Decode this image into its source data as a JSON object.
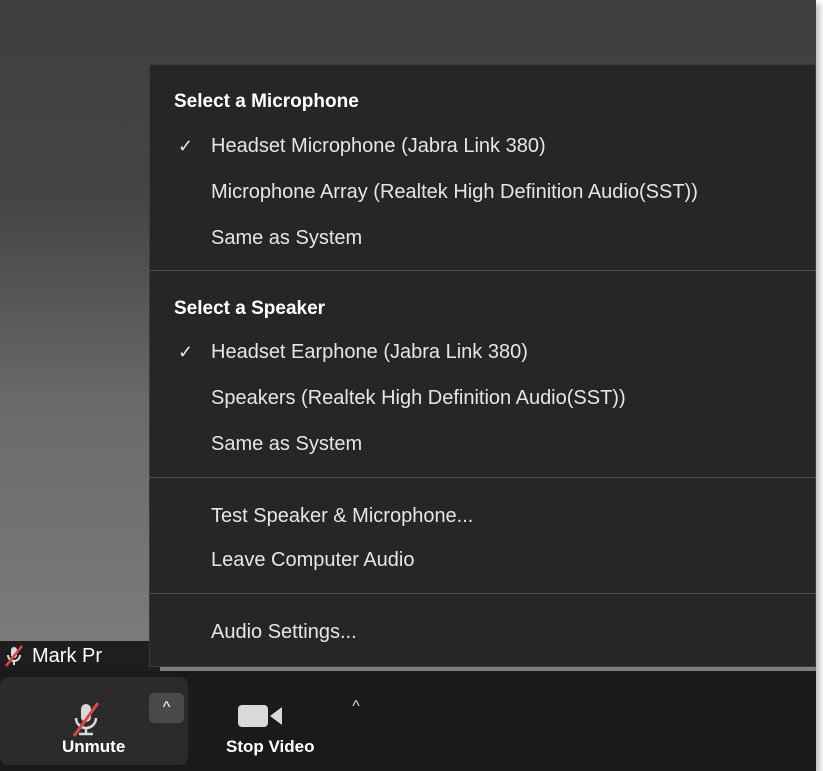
{
  "participant": {
    "name": "Mark Pr"
  },
  "audio_menu": {
    "microphone_section": {
      "heading": "Select a Microphone",
      "options": [
        {
          "label": "Headset Microphone (Jabra Link 380)",
          "selected": true
        },
        {
          "label": "Microphone Array (Realtek High Definition Audio(SST))",
          "selected": false
        },
        {
          "label": "Same as System",
          "selected": false
        }
      ]
    },
    "speaker_section": {
      "heading": "Select a Speaker",
      "options": [
        {
          "label": "Headset Earphone (Jabra Link 380)",
          "selected": true
        },
        {
          "label": "Speakers (Realtek High Definition Audio(SST))",
          "selected": false
        },
        {
          "label": "Same as System",
          "selected": false
        }
      ]
    },
    "check_glyph": "✓",
    "actions": {
      "test": "Test Speaker & Microphone...",
      "leave": "Leave Computer Audio",
      "settings": "Audio Settings..."
    }
  },
  "toolbar": {
    "unmute_label": "Unmute",
    "stop_video_label": "Stop Video",
    "caret_glyph": "^"
  },
  "icons": {
    "mute": "muted-microphone-icon",
    "camera": "video-camera-icon",
    "caret": "caret-up-icon",
    "check": "checkmark-icon"
  },
  "colors": {
    "menu_bg": "#262626",
    "toolbar_bg": "#1a1a1a",
    "mute_slash": "#e0473c",
    "text": "#e6e6e6"
  }
}
